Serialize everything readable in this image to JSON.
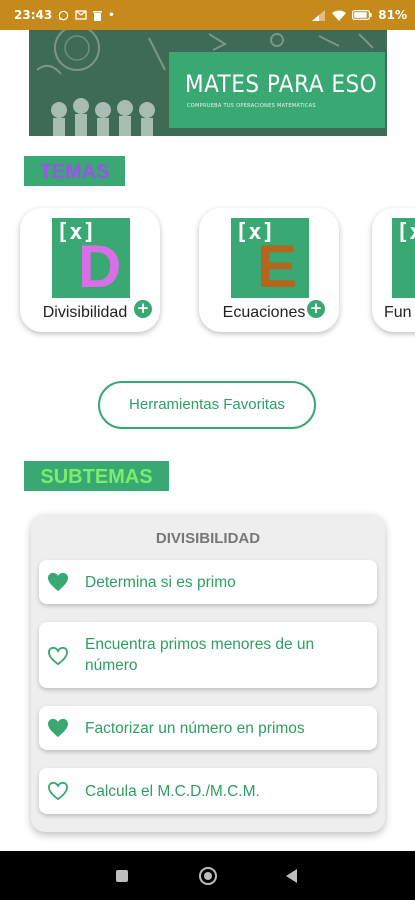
{
  "status_bar": {
    "time": "23:43",
    "battery": "81%"
  },
  "banner": {
    "title": "MATES PARA ESO",
    "subtitle": "COMPRUEBA TUS OPERACIONES MATEMÁTICAS"
  },
  "sections": {
    "temas": "TEMAS",
    "subtemas": "SUBTEMAS"
  },
  "topics": [
    {
      "name": "Divisibilidad",
      "tile_mark": "[x]",
      "letter": "D",
      "letter_color": "#d86ee8",
      "plus": "+"
    },
    {
      "name": "Ecuaciones",
      "tile_mark": "[x]",
      "letter": "E",
      "letter_color": "#b5651d",
      "plus": "+"
    },
    {
      "name": "Fun",
      "tile_mark": "[x]"
    }
  ],
  "favorites_button": "Herramientas Favoritas",
  "subtopics_panel": {
    "title": "DIVISIBILIDAD",
    "items": [
      {
        "line1": "Determina si es primo",
        "line2": "",
        "favorite": true
      },
      {
        "line1": "Encuentra primos menores de un",
        "line2": "número",
        "favorite": false
      },
      {
        "line1": "Factorizar un número en primos",
        "line2": "",
        "favorite": true
      },
      {
        "line1": "Calcula el M.C.D./M.C.M.",
        "line2": "",
        "favorite": false
      }
    ]
  },
  "colors": {
    "accent_green": "#39a872",
    "status_bar": "#c68a1c"
  }
}
